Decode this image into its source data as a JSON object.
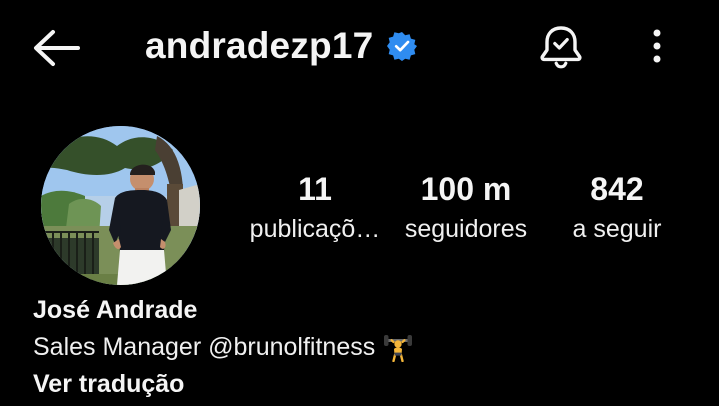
{
  "header": {
    "username": "andradezp17",
    "icons": {
      "back": "back-arrow-icon",
      "verified": "verified-badge-icon",
      "notifications": "bell-check-icon",
      "more": "more-vertical-icon"
    },
    "colors": {
      "verified_badge": "#2f8cf0"
    }
  },
  "profile": {
    "stats": {
      "posts_value": "11",
      "posts_label": "publicaçõ…",
      "followers_value": "100 m",
      "followers_label": "seguidores",
      "following_value": "842",
      "following_label": "a seguir"
    },
    "name": "José Andrade",
    "bio_text": "Sales Manager ",
    "bio_mention": "@brunolfitness",
    "bio_emoji": "weightlifter-emoji",
    "translate_label": "Ver tradução"
  },
  "theme": {
    "background": "#000000",
    "text": "#f5f5f5"
  }
}
